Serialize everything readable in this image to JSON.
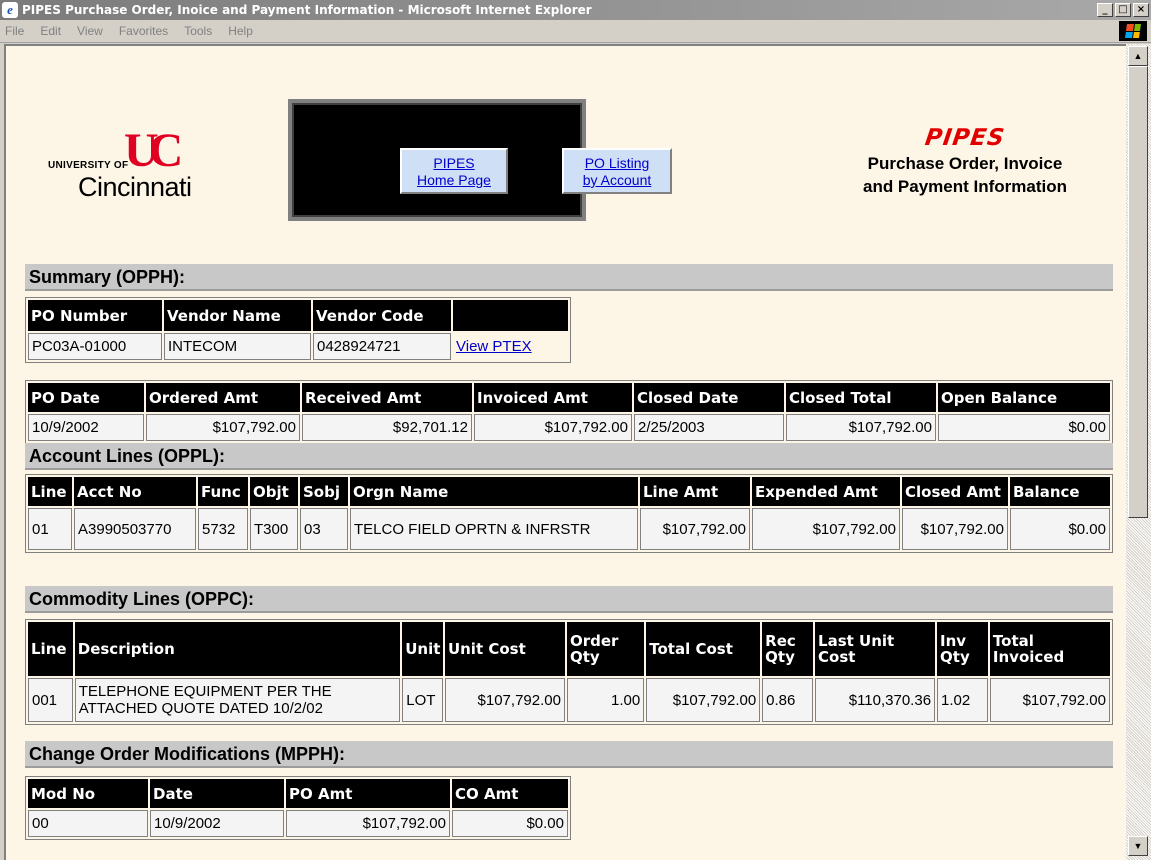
{
  "window": {
    "title": "PIPES Purchase Order, Inoice and Payment Information - Microsoft Internet Explorer",
    "controls": {
      "minimize": "_",
      "maximize": "□",
      "close": "×"
    }
  },
  "menubar": [
    "File",
    "Edit",
    "View",
    "Favorites",
    "Tools",
    "Help"
  ],
  "header": {
    "university_prefix": "UNIVERSITY OF",
    "university_name": "Cincinnati",
    "university_mark": "UC",
    "nav": [
      {
        "line1": "PIPES",
        "line2": "Home Page"
      },
      {
        "line1": "PO Listing",
        "line2": "by Account"
      }
    ],
    "pipes_logo": "PIPES",
    "subtitle_line1": "Purchase Order, Invoice",
    "subtitle_line2": "and Payment Information"
  },
  "summary": {
    "heading": "Summary (OPPH):",
    "vendor_table": {
      "headers": [
        "PO Number",
        "Vendor Name",
        "Vendor Code",
        ""
      ],
      "row": [
        "PC03A-01000",
        "INTECOM",
        "0428924721"
      ],
      "view_link": "View PTEX"
    },
    "amounts_table": {
      "headers": [
        "PO Date",
        "Ordered Amt",
        "Received Amt",
        "Invoiced Amt",
        "Closed Date",
        "Closed Total",
        "Open Balance"
      ],
      "row": [
        "10/9/2002",
        "$107,792.00",
        "$92,701.12",
        "$107,792.00",
        "2/25/2003",
        "$107,792.00",
        "$0.00"
      ]
    }
  },
  "account_lines": {
    "heading": "Account Lines (OPPL):",
    "headers": [
      "Line",
      "Acct No",
      "Func",
      "Objt",
      "Sobj",
      "Orgn Name",
      "Line Amt",
      "Expended Amt",
      "Closed Amt",
      "Balance"
    ],
    "row": [
      "01",
      "A3990503770",
      "5732",
      "T300",
      "03",
      "TELCO FIELD OPRTN & INFRSTR",
      "$107,792.00",
      "$107,792.00",
      "$107,792.00",
      "$0.00"
    ]
  },
  "commodity_lines": {
    "heading": "Commodity Lines (OPPC):",
    "headers": [
      "Line",
      "Description",
      "Unit",
      "Unit Cost",
      "Order Qty",
      "Total Cost",
      "Rec Qty",
      "Last Unit Cost",
      "Inv Qty",
      "Total Invoiced"
    ],
    "row": [
      "001",
      "TELEPHONE EQUIPMENT PER THE ATTACHED QUOTE DATED 10/2/02",
      "LOT",
      "$107,792.00",
      "1.00",
      "$107,792.00",
      "0.86",
      "$110,370.36",
      "1.02",
      "$107,792.00"
    ]
  },
  "change_orders": {
    "heading": "Change Order Modifications (MPPH):",
    "headers": [
      "Mod No",
      "Date",
      "PO Amt",
      "CO Amt"
    ],
    "row": [
      "00",
      "10/9/2002",
      "$107,792.00",
      "$0.00"
    ]
  },
  "scrollbar": {
    "up": "▲",
    "down": "▼"
  }
}
